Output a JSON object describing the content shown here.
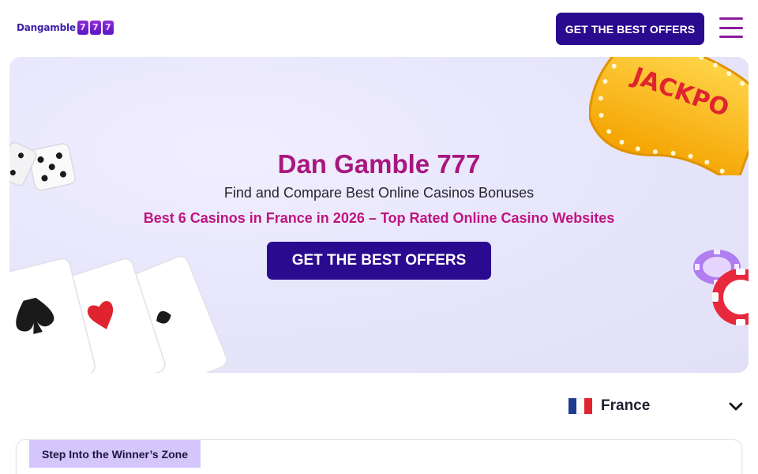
{
  "header": {
    "logo_text": "Dangamble",
    "logo_reels": [
      "7",
      "7",
      "7"
    ],
    "cta_label": "GET THE BEST OFFERS",
    "menu_icon": "hamburger-menu-icon"
  },
  "hero": {
    "title": "Dan Gamble 777",
    "subtitle": "Find and Compare Best Online Casinos Bonuses",
    "tagline": "Best 6 Casinos in France in 2026 – Top Rated Online Casino Websites",
    "cta_label": "GET THE BEST OFFERS",
    "jackpot_text": "JACKPO",
    "decorations": [
      "dice-icon",
      "playing-cards-icon",
      "casino-chips-icon",
      "jackpot-sign-icon"
    ]
  },
  "country_selector": {
    "selected": "France",
    "flag_colors": [
      "#1f3c8f",
      "#ffffff",
      "#e1242f"
    ],
    "chevron_icon": "chevron-down-icon"
  },
  "section": {
    "badge_label": "Step Into the Winner’s Zone"
  },
  "colors": {
    "brand_dark": "#2a0a8f",
    "brand_magenta": "#a8177f",
    "hero_bg": "#e8e6fb",
    "badge_bg": "#d4c6fb"
  }
}
